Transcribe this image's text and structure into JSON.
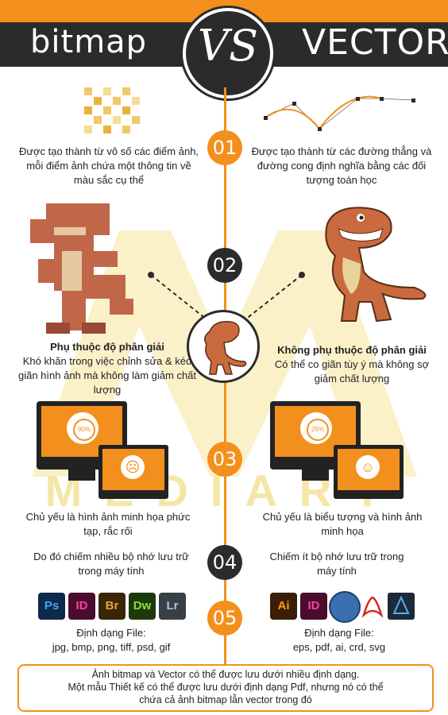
{
  "header": {
    "left_title": "bitmap",
    "vs": "VS",
    "right_title": "VECTOR"
  },
  "colors": {
    "accent": "#f3901d",
    "dark": "#2b2b2b",
    "watermark": "#f6e6a6"
  },
  "steps": [
    "01",
    "02",
    "03",
    "04",
    "05"
  ],
  "row1": {
    "left": "Được tạo thành từ vô số các điểm ảnh, mỗi điểm ảnh chứa một thông tin về màu sắc cụ thể",
    "right": "Được tạo thành từ các đường thẳng và đường cong định nghĩa bằng các đối tượng toán học"
  },
  "row2": {
    "left_title": "Phụ thuộc độ phân giải",
    "left_body": "Khó khăn trong việc chỉnh sửa & kéo giãn hình ảnh mà không làm giảm chất lượng",
    "right_title": "Không phụ thuộc độ phân giải",
    "right_body": "Có thể co giãn tùy ý mà không sợ giảm chất lượng"
  },
  "row3": {
    "left_percent": "90%",
    "right_percent": "25%",
    "left": "Chủ yếu là hình ảnh minh họa phức tạp, rắc rối",
    "right": "Chủ yếu là biểu tượng và hình ảnh minh họa"
  },
  "row4": {
    "left": "Do đó chiếm nhiều bộ nhớ lưu trữ trong máy tính",
    "right": "Chiếm ít bộ nhớ lưu trữ trong máy tính"
  },
  "row5": {
    "left_icons": [
      "Ps",
      "ID",
      "Br",
      "Dw",
      "Lr"
    ],
    "right_icons": [
      "Ai",
      "ID"
    ],
    "left_label": "Định dạng File:",
    "left_formats": "jpg, bmp, png, tiff, psd, gif",
    "right_label": "Định dạng File:",
    "right_formats": "eps, pdf, ai, crd, svg"
  },
  "watermark": "MEDIART",
  "footer": {
    "line1": "Ảnh bitmap và Vector có thể được lưu dưới nhiều định dạng.",
    "line2": "Một mẫu Thiết kế có thể được lưu dưới định dạng Pdf, nhưng nó có thể",
    "line3": "chứa cả ảnh bitmap lẫn vector trong đó"
  }
}
